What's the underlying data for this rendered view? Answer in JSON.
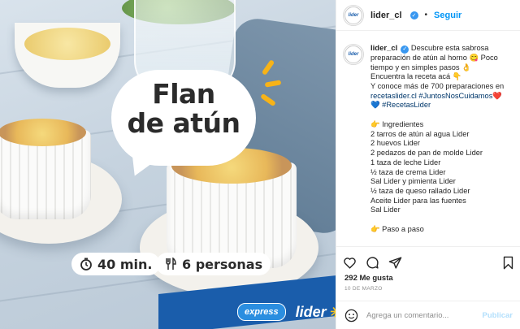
{
  "photo": {
    "bubble_line1": "Flan",
    "bubble_line2": "de atún",
    "time_label": "40 min.",
    "servings_label": "6 personas",
    "express_label": "express",
    "brand_label": "lider",
    "icons": [
      "timer-icon",
      "cutlery-icon",
      "walmart-spark-icon"
    ]
  },
  "post": {
    "header": {
      "username": "lider_cl",
      "separator": "•",
      "follow_label": "Seguir",
      "avatar_text": "lider"
    },
    "caption": {
      "username": "lider_cl",
      "lines": [
        "Descubre esta sabrosa",
        "preparación de atún al horno 😋 Poco",
        "tiempo y en simples pasos 👌",
        "Encuentra la receta acá 👇",
        "Y conoce más de 700 preparaciones en",
        "recetaslider.cl #JuntosNosCuidamos❤️",
        "💙 #RecetasLider"
      ],
      "ingredients_title": "👉 Ingredientes",
      "ingredients": [
        "2 tarros de atún al agua Lider",
        "2 huevos Lider",
        "2 pedazos de pan de molde Lider",
        "1 taza de leche Lider",
        "½ taza de crema Lider",
        "Sal Lider y pimienta Lider",
        "½ taza de queso rallado Lider",
        "Aceite Lider para las fuentes",
        "Sal Lider"
      ],
      "steps_title": "👉 Paso a paso"
    },
    "likes_text": "292 Me gusta",
    "date_text": "10 DE MARZO",
    "comment_placeholder": "Agrega un comentario...",
    "publish_label": "Publicar"
  },
  "colors": {
    "brand_blue": "#1a5dab",
    "spark_yellow": "#f7b318",
    "follow_blue": "#0095f6",
    "hashtag": "#00376b"
  }
}
